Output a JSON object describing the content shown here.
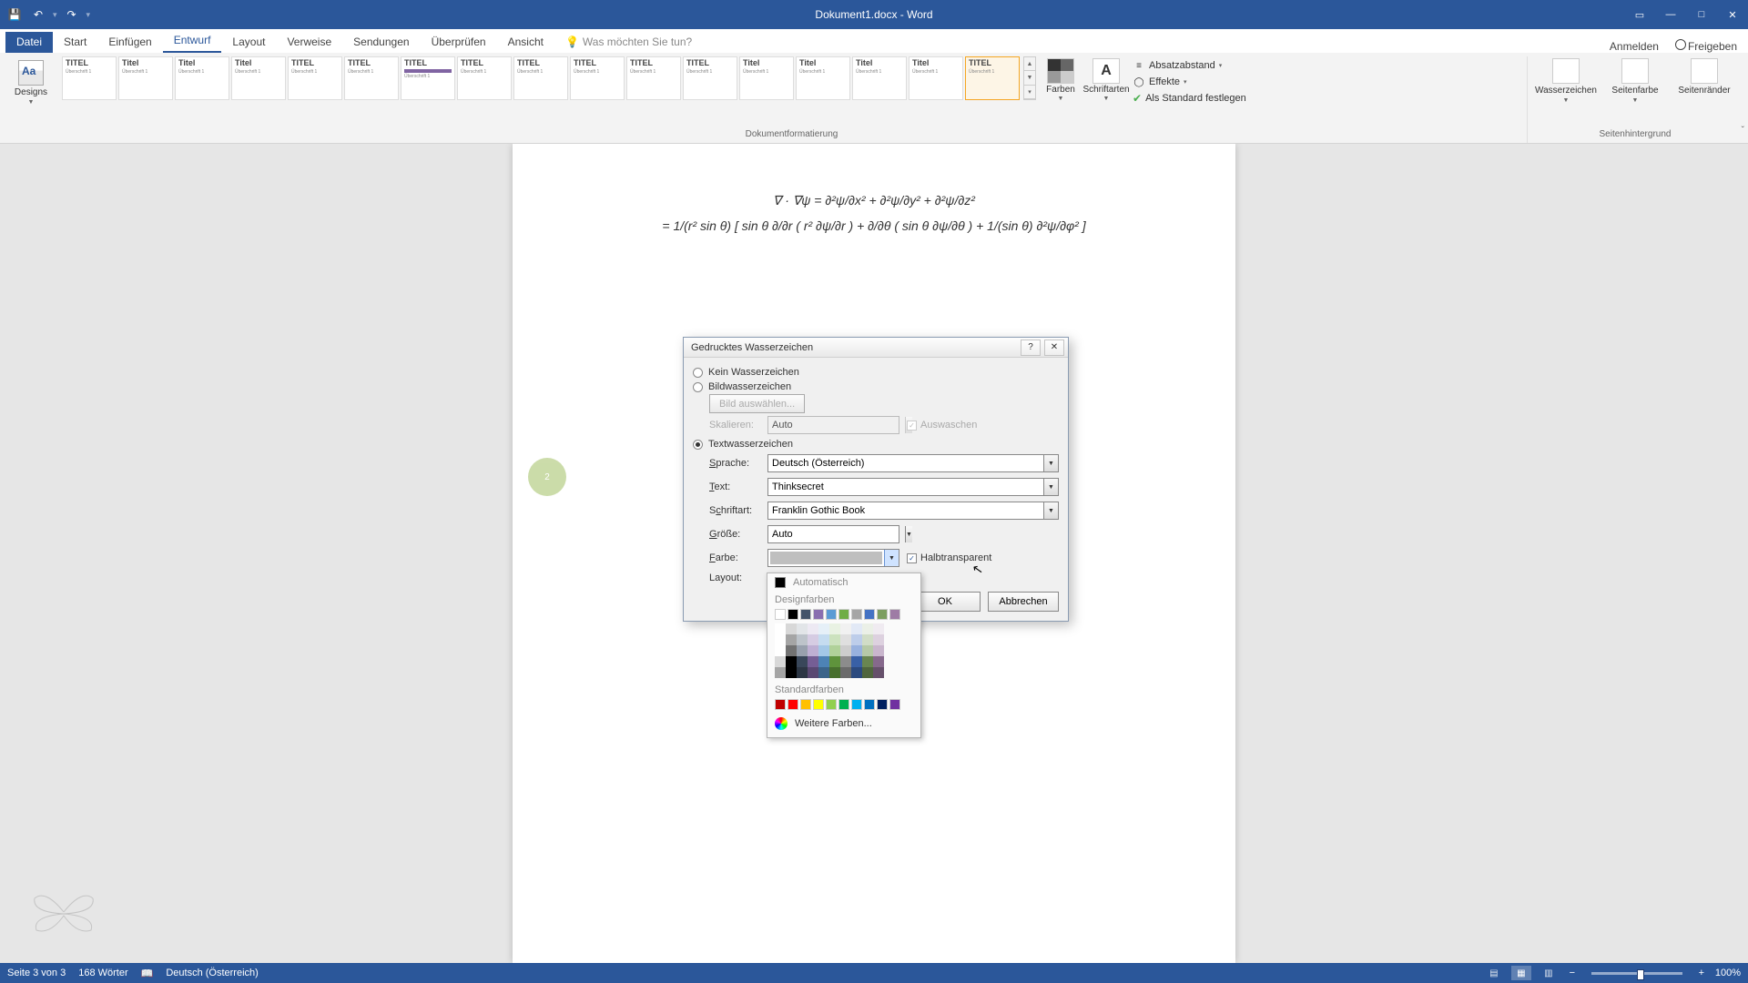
{
  "titlebar": {
    "doc_title": "Dokument1.docx - Word"
  },
  "tabs": {
    "file": "Datei",
    "home": "Start",
    "insert": "Einfügen",
    "design": "Entwurf",
    "layout": "Layout",
    "references": "Verweise",
    "mailings": "Sendungen",
    "review": "Überprüfen",
    "view": "Ansicht",
    "tellme_placeholder": "Was möchten Sie tun?",
    "signin": "Anmelden",
    "share": "Freigeben"
  },
  "ribbon": {
    "designs_label": "Designs",
    "docformat_label": "Dokumentformatierung",
    "pagebg_label": "Seitenhintergrund",
    "gallery_titles": [
      "TITEL",
      "Titel",
      "Titel",
      "Titel",
      "TITEL",
      "TITEL",
      "TITEL",
      "TITEL",
      "TITEL",
      "TITEL",
      "TITEL",
      "TITEL",
      "Titel",
      "Titel",
      "Titel",
      "Titel",
      "TITEL"
    ],
    "colors": "Farben",
    "fonts": "Schriftarten",
    "para_spacing": "Absatzabstand",
    "effects": "Effekte",
    "set_default": "Als Standard festlegen",
    "watermark": "Wasserzeichen",
    "pagecolor": "Seitenfarbe",
    "pageborders": "Seitenränder"
  },
  "equation": {
    "line1": "∇ · ∇ψ = ∂²ψ/∂x² + ∂²ψ/∂y² + ∂²ψ/∂z²",
    "line2": "= 1/(r² sin θ) [ sin θ ∂/∂r ( r² ∂ψ/∂r ) + ∂/∂θ ( sin θ ∂ψ/∂θ ) + 1/(sin θ) ∂²ψ/∂φ² ]"
  },
  "dialog": {
    "title": "Gedrucktes Wasserzeichen",
    "radio_none": "Kein Wasserzeichen",
    "radio_picture": "Bildwasserzeichen",
    "btn_select_picture": "Bild auswählen...",
    "label_scale": "Skalieren:",
    "scale_value": "Auto",
    "chk_washout": "Auswaschen",
    "radio_text": "Textwasserzeichen",
    "label_language": "Sprache:",
    "language_value": "Deutsch (Österreich)",
    "label_text": "Text:",
    "text_value": "Thinksecret",
    "label_font": "Schriftart:",
    "font_value": "Franklin Gothic Book",
    "label_size": "Größe:",
    "size_value": "Auto",
    "label_color": "Farbe:",
    "chk_semitrans": "Halbtransparent",
    "label_layout": "Layout:",
    "btn_ok": "OK",
    "btn_cancel": "Abbrechen"
  },
  "colorpicker": {
    "automatic": "Automatisch",
    "theme_colors": "Designfarben",
    "standard_colors": "Standardfarben",
    "more_colors": "Weitere Farben...",
    "theme_row": [
      "#ffffff",
      "#000000",
      "#44546a",
      "#8a6fb0",
      "#5b9bd5",
      "#70ad47",
      "#a5a5a5",
      "#4472c4",
      "#7c9e60",
      "#9e7ca5"
    ],
    "std_row": [
      "#c00000",
      "#ff0000",
      "#ffc000",
      "#ffff00",
      "#92d050",
      "#00b050",
      "#00b0f0",
      "#0070c0",
      "#002060",
      "#7030a0"
    ]
  },
  "statusbar": {
    "page": "Seite 3 von 3",
    "words": "168 Wörter",
    "lang": "Deutsch (Österreich)",
    "zoom": "100%"
  }
}
